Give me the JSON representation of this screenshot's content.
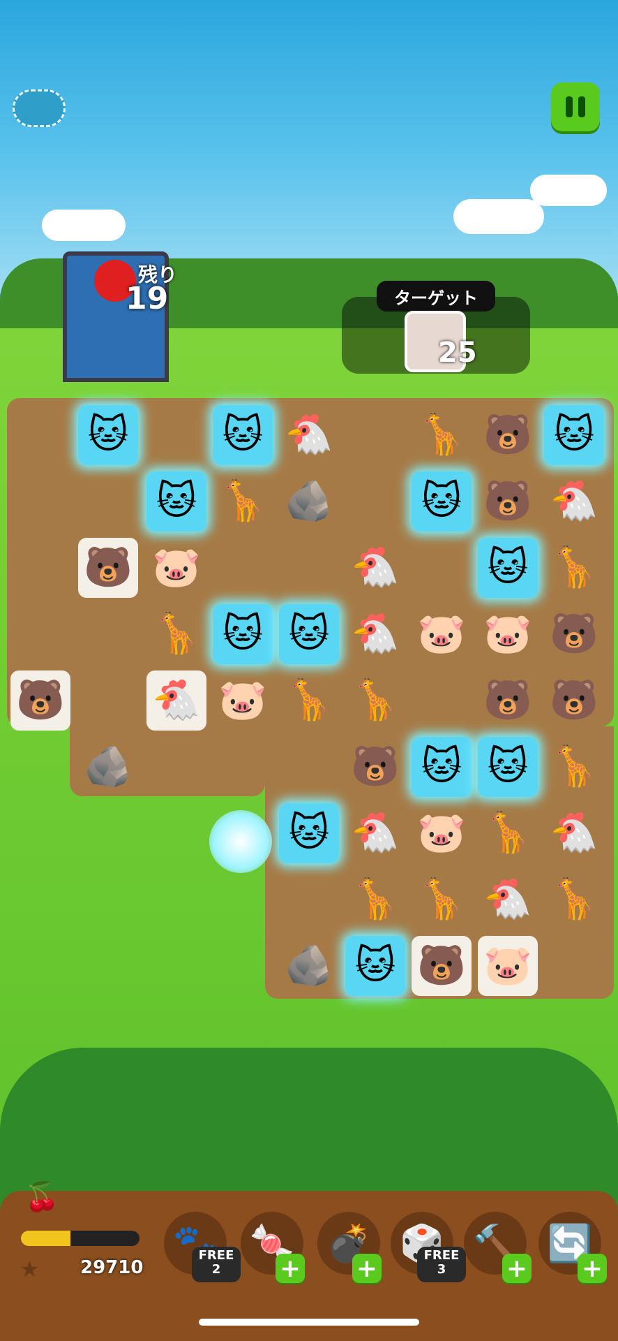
{
  "hud": {
    "moves_label": "残り",
    "moves_value": "19",
    "target_label": "ターゲット",
    "target_count": "25",
    "score": "29710"
  },
  "boosters": [
    {
      "name": "paw",
      "icon": "🐾",
      "badge": "FREE",
      "badge_value": "2"
    },
    {
      "name": "candy",
      "icon": "🍬",
      "badge": "+",
      "badge_value": ""
    },
    {
      "name": "bomb",
      "icon": "💣",
      "badge": "+",
      "badge_value": ""
    },
    {
      "name": "dice",
      "icon": "🎲",
      "badge": "FREE",
      "badge_value": "3"
    },
    {
      "name": "hammer",
      "icon": "🔨",
      "badge": "+",
      "badge_value": ""
    },
    {
      "name": "shuffle",
      "icon": "🔄",
      "badge": "+",
      "badge_value": ""
    }
  ],
  "colors": {
    "pause": "#5acb1e",
    "board": "#a67a46",
    "sky": "#2aa6dd"
  }
}
